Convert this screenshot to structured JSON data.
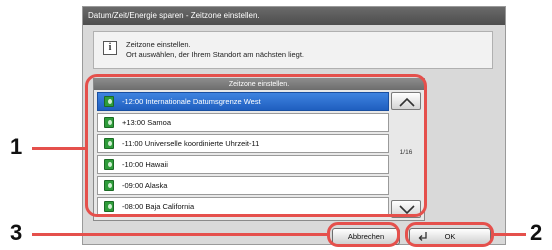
{
  "dialog": {
    "title": "Datum/Zeit/Energie sparen - Zeitzone einstellen.",
    "info_lines": [
      "Zeitzone einstellen.",
      "Ort auswählen, der Ihrem Standort am nächsten liegt."
    ]
  },
  "list": {
    "header": "Zeitzone einstellen.",
    "items": [
      {
        "label": "-12:00 Internationale Datumsgrenze West",
        "selected": true
      },
      {
        "label": "+13:00 Samoa",
        "selected": false
      },
      {
        "label": "-11:00 Universelle koordinierte Uhrzeit-11",
        "selected": false
      },
      {
        "label": "-10:00 Hawaii",
        "selected": false
      },
      {
        "label": "-09:00 Alaska",
        "selected": false
      },
      {
        "label": "-08:00 Baja California",
        "selected": false
      }
    ],
    "page_indicator": "1/16"
  },
  "buttons": {
    "cancel_label": "Abbrechen",
    "ok_label": "OK"
  },
  "callouts": {
    "one": "1",
    "two": "2",
    "three": "3"
  },
  "colors": {
    "highlight_ring": "#e5504c",
    "selected_row": "#2f6fd0"
  }
}
